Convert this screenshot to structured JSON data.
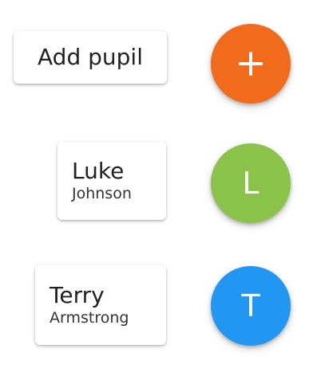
{
  "add_pupil": {
    "label": "Add pupil",
    "icon": "plus-icon",
    "color": "#F26B1D"
  },
  "pupils": [
    {
      "first_name": "Luke",
      "last_name": "Johnson",
      "initial": "L",
      "color": "#8BC34A"
    },
    {
      "first_name": "Terry",
      "last_name": "Armstrong",
      "initial": "T",
      "color": "#2196F3"
    }
  ]
}
